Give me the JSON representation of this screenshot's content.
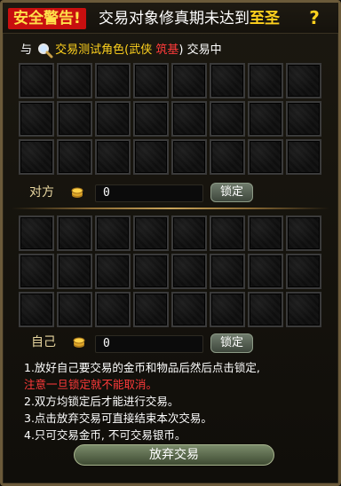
{
  "header": {
    "warning_badge": "安全警告!",
    "warning_text": "交易对象修真期未达到",
    "warning_realm": "至圣",
    "help": "?"
  },
  "partner": {
    "prefix": "与",
    "name": "交易测试角色(武侠",
    "realm": "筑基",
    "suffix": ") 交易中"
  },
  "partner_trade": {
    "side_label": "对方",
    "money": "0",
    "lock_label": "锁定",
    "slots": 24
  },
  "own_trade": {
    "side_label": "自己",
    "money": "0",
    "lock_label": "锁定",
    "slots": 24
  },
  "rules": {
    "line1": "1.放好自己要交易的金币和物品后然后点击锁定,",
    "line1_warning": "注意一旦锁定就不能取消。",
    "line2": "2.双方均锁定后才能进行交易。",
    "line3": "3.点击放弃交易可直接结束本次交易。",
    "line4": "4.只可交易金币, 不可交易银币。"
  },
  "actions": {
    "cancel_trade": "放弃交易"
  },
  "colors": {
    "warning_red": "#c80f0f",
    "gold_text": "#ffd21e",
    "realm_red": "#ff3a3a"
  },
  "icons": {
    "help": "question-mark-icon",
    "search": "magnifier-icon",
    "currency": "gold-coin-icon"
  }
}
